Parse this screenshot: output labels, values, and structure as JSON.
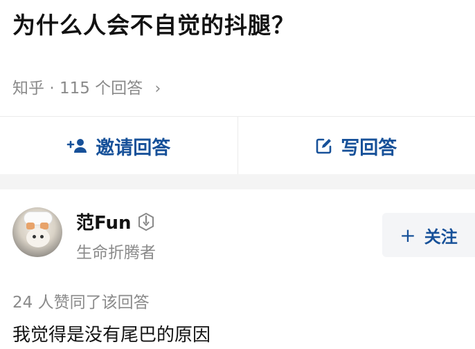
{
  "question": {
    "title": "为什么人会不自觉的抖腿？"
  },
  "meta": {
    "source": "知乎",
    "separator": "·",
    "answer_count": "115 个回答",
    "chevron": "›"
  },
  "actions": {
    "invite_label": "邀请回答",
    "write_label": "写回答"
  },
  "answer": {
    "author_name": "范Fun",
    "author_bio": "生命折腾者",
    "follow_plus": "+",
    "follow_label": "关注",
    "votes_text": "24 人赞同了该回答",
    "content": "我觉得是没有尾巴的原因"
  },
  "colors": {
    "accent": "#175199",
    "muted": "#8a8a8a",
    "text": "#121212"
  },
  "icons": {
    "invite": "add-person-icon",
    "write": "edit-icon",
    "verified": "verified-badge-icon",
    "more": "chevron-right-icon"
  }
}
